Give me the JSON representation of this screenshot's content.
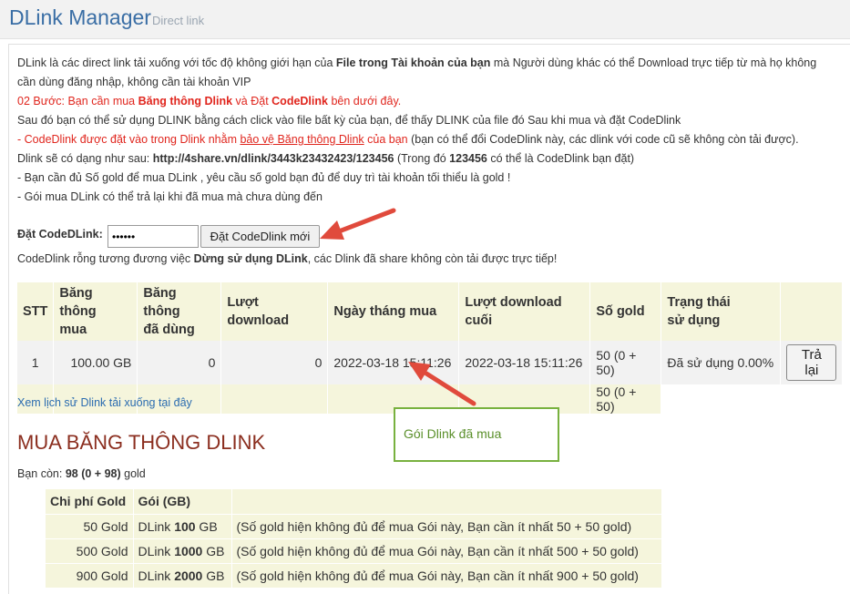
{
  "header": {
    "title": "DLink Manager",
    "subtitle": "Direct link"
  },
  "intro": {
    "l1a": "DLink là các direct link tải xuống với tốc độ không giới hạn của ",
    "l1b": "File trong Tài khoản của bạn",
    "l1c": " mà Người dùng khác có thể Download trực tiếp từ mà họ không",
    "l2": "cần dùng đăng nhập, không cần tài khoản VIP",
    "l3a": "02 Bước: Bạn cần mua ",
    "l3b": "Băng thông Dlink",
    "l3c": " và Đặt ",
    "l3d": "CodeDlink",
    "l3e": " bên dưới đây.",
    "l4": "Sau đó bạn có thể sử dụng DLINK bằng cách click vào file bất kỳ của bạn, để thấy DLINK của file đó Sau khi mua và đặt CodeDlink",
    "l5a": "- CodeDlink được đặt vào trong Dlink nhằm ",
    "l5b": "bảo vệ Băng thông Dlink",
    "l5c": " của bạn",
    "l5d": " (bạn có thể đổi CodeDlink này, các dlink với code cũ sẽ không còn tải được).",
    "l6a": "Dlink sẽ có dạng như sau: ",
    "l6b": "http://4share.vn/dlink/3443k23432423/123456",
    "l6c": " (Trong đó ",
    "l6d": "123456",
    "l6e": " có thể là CodeDlink bạn đặt)",
    "l7": "- Bạn cần đủ Số gold để mua DLink , yêu cầu số gold bạn đủ để duy trì tài khoản tối thiểu là gold !",
    "l8": "- Gói mua DLink có thể trả lại khi đã mua mà chưa dùng đến"
  },
  "codedlink": {
    "label": "Đặt CodeDLink:",
    "value": "••••••",
    "button": "Đặt CodeDlink mới",
    "note_a": "CodeDlink rỗng tương đương việc ",
    "note_b": "Dừng sử dụng DLink",
    "note_c": ", các Dlink đã share không còn tải được trực tiếp!"
  },
  "table": {
    "headers": {
      "stt": "STT",
      "bw1": "Băng thông",
      "bw2": "mua",
      "used1": "Băng thông",
      "used2": "đã dùng",
      "dl": "Lượt download",
      "date": "Ngày tháng mua",
      "last1": "Lượt download",
      "last2": "cuối",
      "gold": "Số gold",
      "status1": "Trạng thái",
      "status2": "sử dụng"
    },
    "row": {
      "stt": "1",
      "bw": "100.00 GB",
      "used": "0",
      "dl": "0",
      "date": "2022-03-18 15:11:26",
      "last": "2022-03-18 15:11:26",
      "gold": "50 (0 + 50)",
      "status": "Đã sử dụng 0.00%",
      "action": "Trả lại"
    },
    "total_gold": "50 (0 + 50)"
  },
  "history_link": "Xem lịch sử Dlink tải xuống tại đây",
  "callout": "Gói Dlink đã mua",
  "buy": {
    "title": "MUA BĂNG THÔNG DLINK",
    "remain_a": "Bạn còn: ",
    "remain_b": "98 (0 + 98)",
    "remain_c": " gold",
    "h_cost": "Chi phí Gold",
    "h_pack": "Gói (GB)",
    "rows": [
      {
        "cost": "50 Gold",
        "pre": "DLink ",
        "size": "100",
        "unit": " GB",
        "note": "(Số gold hiện không đủ để mua Gói này, Bạn cần ít nhất 50 + 50 gold)"
      },
      {
        "cost": "500 Gold",
        "pre": "DLink ",
        "size": "1000",
        "unit": " GB",
        "note": "(Số gold hiện không đủ để mua Gói này, Bạn cần ít nhất 500 + 50 gold)"
      },
      {
        "cost": "900 Gold",
        "pre": "DLink ",
        "size": "2000",
        "unit": " GB",
        "note": "(Số gold hiện không đủ để mua Gói này, Bạn cần ít nhất 900 + 50 gold)"
      }
    ]
  },
  "colors": {
    "link": "#2b6cb0",
    "warn": "#e0261e",
    "arrow": "#e04a3c",
    "callout": "#78b13f",
    "table_bg": "#f5f5dc"
  }
}
